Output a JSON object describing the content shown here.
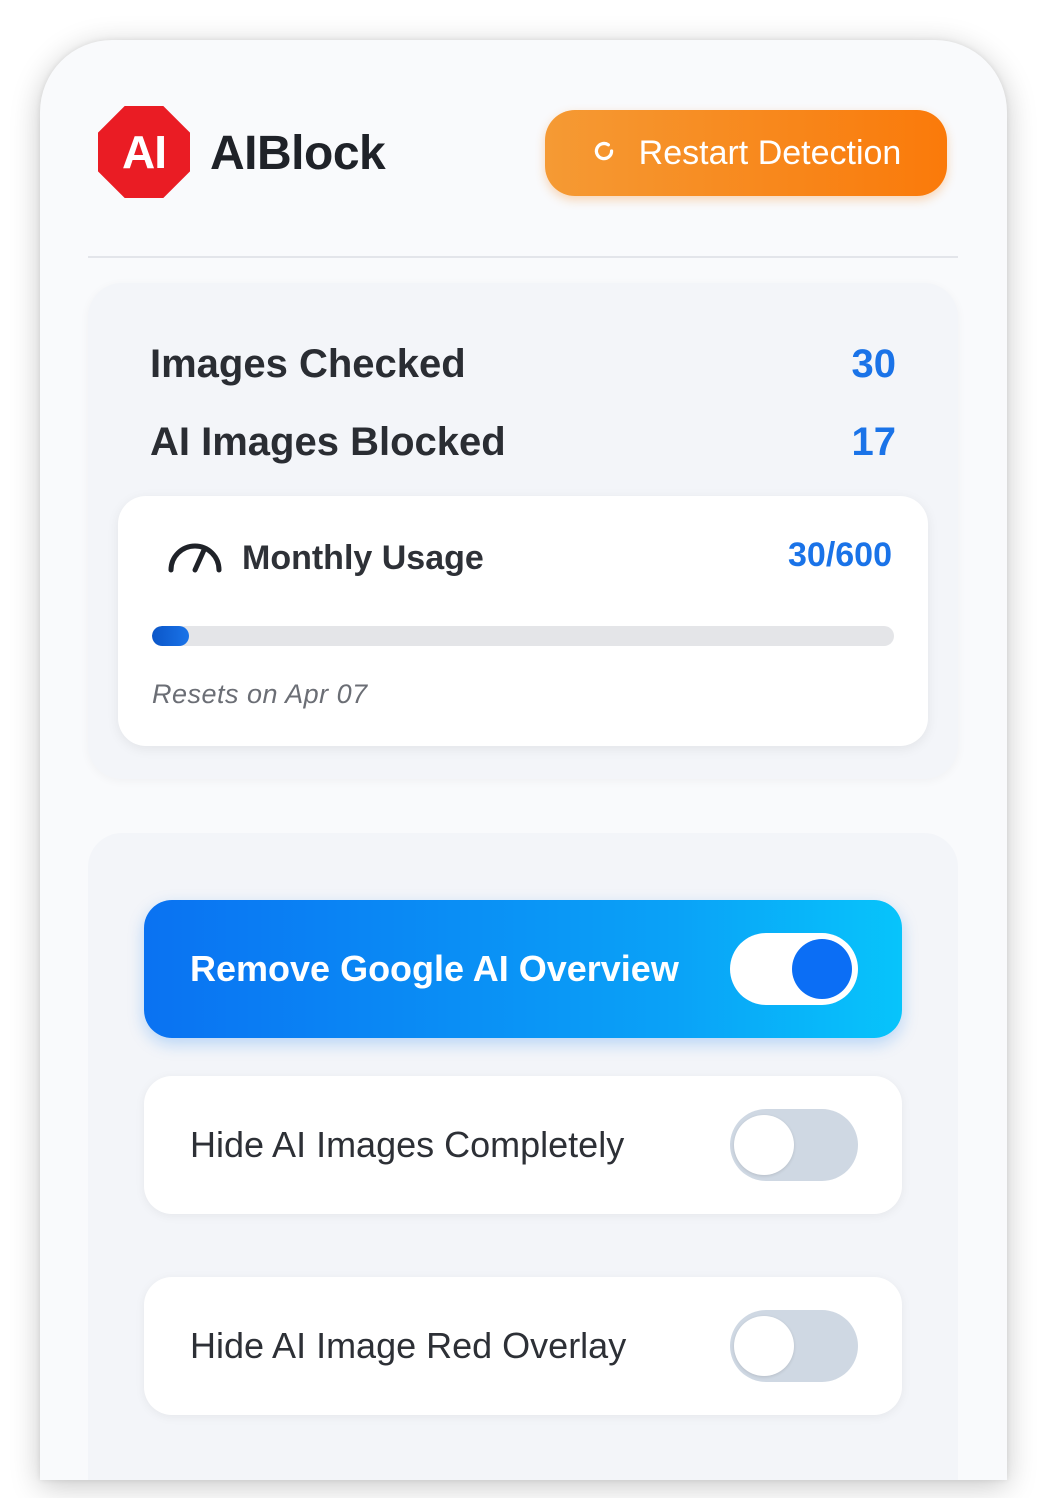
{
  "header": {
    "logo_text": "AI",
    "app_name": "AIBlock",
    "restart_label": "Restart Detection"
  },
  "stats": {
    "images_checked_label": "Images Checked",
    "images_checked_value": "30",
    "ai_blocked_label": "AI Images Blocked",
    "ai_blocked_value": "17"
  },
  "usage": {
    "label": "Monthly Usage",
    "count_text": "30/600",
    "used": 30,
    "limit": 600,
    "reset_text": "Resets on Apr 07"
  },
  "toggles": [
    {
      "label": "Remove Google AI Overview",
      "on": true
    },
    {
      "label": "Hide AI Images Completely",
      "on": false
    },
    {
      "label": "Hide AI Image Red Overlay",
      "on": false
    }
  ],
  "colors": {
    "accent_blue": "#1a73e8",
    "logo_red": "#ea1c24",
    "restart_orange": "#f98a1c"
  }
}
